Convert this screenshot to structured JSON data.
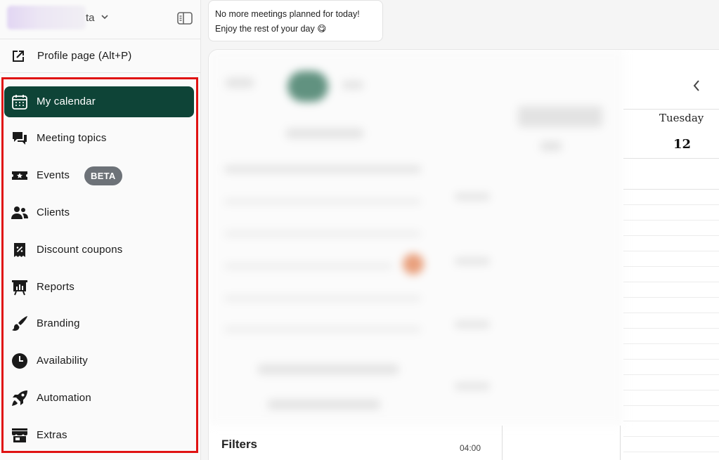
{
  "account": {
    "name_suffix": "ta",
    "chevron_icon": "chevron-down-icon",
    "collapse_icon": "sidebar-collapse-icon"
  },
  "profile_link": {
    "label": "Profile page (Alt+P)",
    "icon": "external-link-icon"
  },
  "nav": {
    "items": [
      {
        "label": "My calendar",
        "icon": "calendar-icon",
        "active": true
      },
      {
        "label": "Meeting topics",
        "icon": "chat-bubbles-icon"
      },
      {
        "label": "Events",
        "icon": "ticket-star-icon",
        "badge": "BETA"
      },
      {
        "label": "Clients",
        "icon": "people-icon"
      },
      {
        "label": "Discount coupons",
        "icon": "coupon-icon"
      },
      {
        "label": "Reports",
        "icon": "presentation-chart-icon"
      },
      {
        "label": "Branding",
        "icon": "paint-brush-icon"
      },
      {
        "label": "Availability",
        "icon": "clock-icon"
      },
      {
        "label": "Automation",
        "icon": "rocket-icon"
      },
      {
        "label": "Extras",
        "icon": "storefront-icon"
      }
    ]
  },
  "notice": {
    "line1": "No more meetings planned for today!",
    "line2": "Enjoy the rest of your day 😋"
  },
  "calendar": {
    "prev_icon": "chevron-left-icon",
    "day_name": "Tuesday",
    "day_number": "12",
    "first_time_label": "04:00"
  },
  "filters": {
    "title": "Filters"
  },
  "colors": {
    "active_nav_bg": "#0e4437",
    "badge_bg": "#6d7278",
    "highlight_frame": "#e01212"
  }
}
